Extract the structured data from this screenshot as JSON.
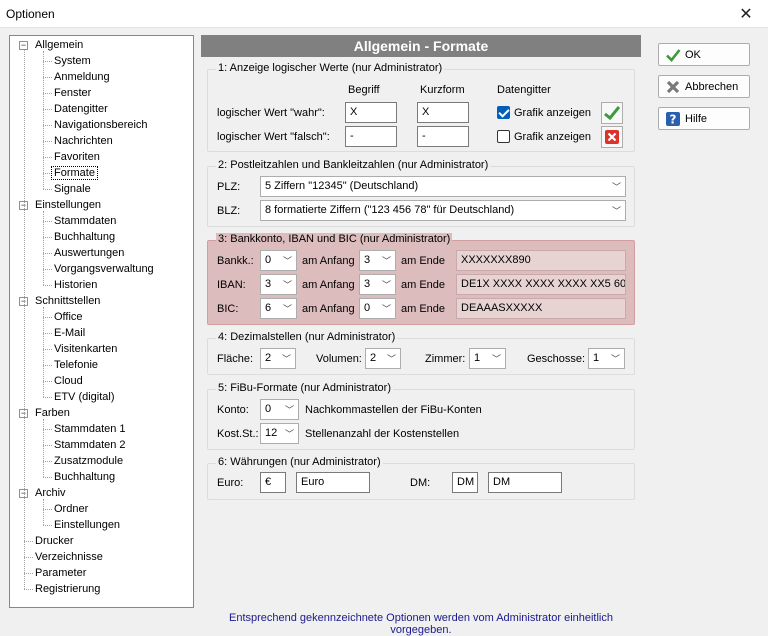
{
  "window": {
    "title": "Optionen"
  },
  "tree": {
    "items": [
      {
        "label": "Allgemein",
        "level": 0,
        "expander": "−"
      },
      {
        "label": "System",
        "level": 1
      },
      {
        "label": "Anmeldung",
        "level": 1
      },
      {
        "label": "Fenster",
        "level": 1
      },
      {
        "label": "Datengitter",
        "level": 1
      },
      {
        "label": "Navigationsbereich",
        "level": 1
      },
      {
        "label": "Nachrichten",
        "level": 1
      },
      {
        "label": "Favoriten",
        "level": 1
      },
      {
        "label": "Formate",
        "level": 1,
        "selected": true
      },
      {
        "label": "Signale",
        "level": 1
      },
      {
        "label": "Einstellungen",
        "level": 0,
        "expander": "−"
      },
      {
        "label": "Stammdaten",
        "level": 1
      },
      {
        "label": "Buchhaltung",
        "level": 1
      },
      {
        "label": "Auswertungen",
        "level": 1
      },
      {
        "label": "Vorgangsverwaltung",
        "level": 1
      },
      {
        "label": "Historien",
        "level": 1
      },
      {
        "label": "Schnittstellen",
        "level": 0,
        "expander": "−"
      },
      {
        "label": "Office",
        "level": 1
      },
      {
        "label": "E-Mail",
        "level": 1
      },
      {
        "label": "Visitenkarten",
        "level": 1
      },
      {
        "label": "Telefonie",
        "level": 1
      },
      {
        "label": "Cloud",
        "level": 1
      },
      {
        "label": "ETV (digital)",
        "level": 1
      },
      {
        "label": "Farben",
        "level": 0,
        "expander": "−"
      },
      {
        "label": "Stammdaten 1",
        "level": 1
      },
      {
        "label": "Stammdaten 2",
        "level": 1
      },
      {
        "label": "Zusatzmodule",
        "level": 1
      },
      {
        "label": "Buchhaltung",
        "level": 1
      },
      {
        "label": "Archiv",
        "level": 0,
        "expander": "−"
      },
      {
        "label": "Ordner",
        "level": 1
      },
      {
        "label": "Einstellungen",
        "level": 1
      },
      {
        "label": "Drucker",
        "level": 0
      },
      {
        "label": "Verzeichnisse",
        "level": 0
      },
      {
        "label": "Parameter",
        "level": 0
      },
      {
        "label": "Registrierung",
        "level": 0
      }
    ]
  },
  "header": {
    "title": "Allgemein - Formate"
  },
  "logic": {
    "title": "1: Anzeige logischer Werte  (nur Administrator)",
    "col_begriff": "Begriff",
    "col_kurzform": "Kurzform",
    "col_datengitter": "Datengitter",
    "row_true_label": "logischer Wert \"wahr\":",
    "row_true_begriff": "X",
    "row_true_kurz": "X",
    "row_true_grafik": "Grafik anzeigen",
    "row_false_label": "logischer Wert \"falsch\":",
    "row_false_begriff": "-",
    "row_false_kurz": "-",
    "row_false_grafik": "Grafik anzeigen"
  },
  "postal": {
    "title": "2: Postleitzahlen und Bankleitzahlen  (nur Administrator)",
    "plz_label": "PLZ:",
    "plz_value": "5 Ziffern \"12345\" (Deutschland)",
    "blz_label": "BLZ:",
    "blz_value": "8 formatierte Ziffern (\"123 456 78\" für Deutschland)"
  },
  "bank": {
    "title": "3: Bankkonto, IBAN und BIC  (nur Administrator)",
    "start_label": "am Anfang",
    "end_label": "am Ende",
    "rows": [
      {
        "label": "Bankk.:",
        "start": "0",
        "end": "3",
        "preview": "XXXXXXX890"
      },
      {
        "label": "IBAN:",
        "start": "3",
        "end": "3",
        "preview": "DE1X XXXX XXXX XXXX XX5 60"
      },
      {
        "label": "BIC:",
        "start": "6",
        "end": "0",
        "preview": "DEAAASXXXXX"
      }
    ]
  },
  "decimal": {
    "title": "4: Dezimalstellen  (nur Administrator)",
    "flaeche_label": "Fläche:",
    "flaeche": "2",
    "volumen_label": "Volumen:",
    "volumen": "2",
    "zimmer_label": "Zimmer:",
    "zimmer": "1",
    "geschosse_label": "Geschosse:",
    "geschosse": "1"
  },
  "fibu": {
    "title": "5: FiBu-Formate  (nur Administrator)",
    "konto_label": "Konto:",
    "konto": "0",
    "konto_desc": "Nachkommastellen der FiBu-Konten",
    "kost_label": "Kost.St.:",
    "kost": "12",
    "kost_desc": "Stellenanzahl der Kostenstellen"
  },
  "currency": {
    "title": "6: Währungen  (nur Administrator)",
    "euro_label": "Euro:",
    "euro_symbol": "€",
    "euro_name": "Euro",
    "dm_label": "DM:",
    "dm_symbol": "DM",
    "dm_name": "DM"
  },
  "buttons": {
    "ok": "OK",
    "cancel": "Abbrechen",
    "help": "Hilfe"
  },
  "footer": {
    "note": "Entsprechend gekennzeichnete Optionen werden vom Administrator einheitlich vorgegeben."
  },
  "colors": {
    "header_bg": "#808080",
    "highlight": "#dcbcbc",
    "check_green": "#3c9a3c",
    "cross_red": "#d9332b"
  }
}
